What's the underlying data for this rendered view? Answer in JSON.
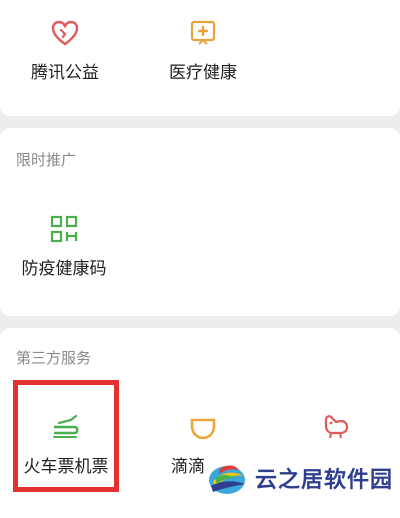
{
  "top_services": [
    {
      "label": "腾讯公益",
      "icon": "heart-charity-icon",
      "color": "#e05a5a"
    },
    {
      "label": "医疗健康",
      "icon": "medical-cross-icon",
      "color": "#e8a33a"
    }
  ],
  "promo": {
    "title": "限时推广",
    "items": [
      {
        "label": "防疫健康码",
        "icon": "qr-code-icon",
        "color": "#4caf50"
      }
    ]
  },
  "third_party": {
    "title": "第三方服务",
    "items": [
      {
        "label": "火车票机票",
        "icon": "train-icon",
        "color": "#4caf50"
      },
      {
        "label": "滴滴",
        "icon": "didi-icon",
        "color": "#f0a53a"
      },
      {
        "label": "",
        "icon": "jd-dog-icon",
        "color": "#e05a5a"
      }
    ]
  },
  "watermark": {
    "text": "云之居软件园"
  }
}
